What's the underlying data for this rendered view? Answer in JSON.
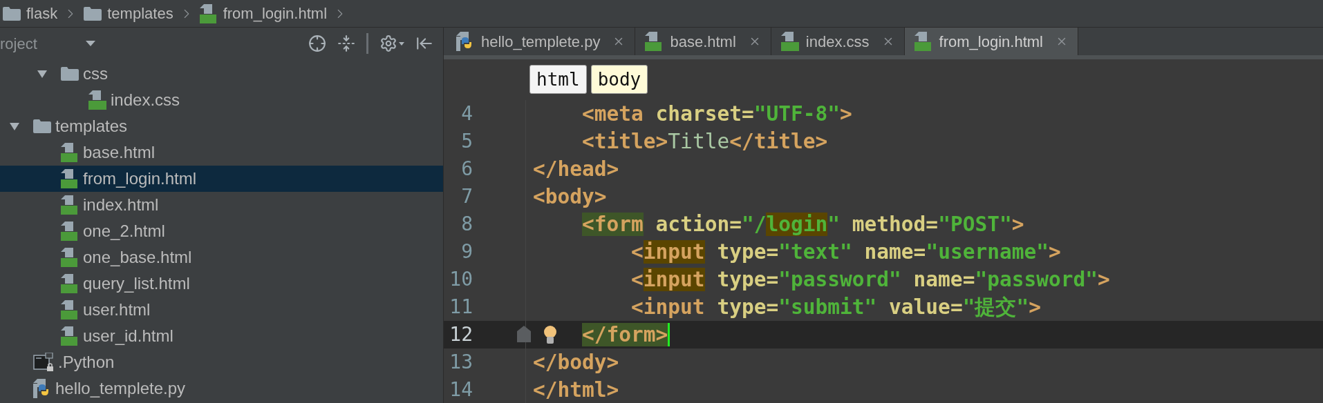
{
  "breadcrumbs": [
    {
      "label": "flask",
      "kind": "folder"
    },
    {
      "label": "templates",
      "kind": "folder"
    },
    {
      "label": "from_login.html",
      "kind": "html"
    }
  ],
  "project_panel": {
    "title": "roject",
    "tree": [
      {
        "kind": "offscreen",
        "children": [
          {
            "label": "css",
            "kind": "folder",
            "expanded": true,
            "selected": false,
            "children": [
              {
                "label": "index.css",
                "kind": "css",
                "selected": false
              }
            ]
          }
        ]
      },
      {
        "label": "templates",
        "kind": "folder",
        "expanded": true,
        "selected": false,
        "children": [
          {
            "label": "base.html",
            "kind": "html",
            "selected": false
          },
          {
            "label": "from_login.html",
            "kind": "html",
            "selected": true
          },
          {
            "label": "index.html",
            "kind": "html",
            "selected": false
          },
          {
            "label": "one_2.html",
            "kind": "html",
            "selected": false
          },
          {
            "label": "one_base.html",
            "kind": "html",
            "selected": false
          },
          {
            "label": "query_list.html",
            "kind": "html",
            "selected": false
          },
          {
            "label": "user.html",
            "kind": "html",
            "selected": false
          },
          {
            "label": "user_id.html",
            "kind": "html",
            "selected": false
          }
        ]
      },
      {
        "label": ".Python",
        "kind": "terminal",
        "selected": false
      },
      {
        "label": "hello_templete.py",
        "kind": "python",
        "selected": false
      }
    ]
  },
  "tabs": [
    {
      "label": "hello_templete.py",
      "kind": "python",
      "selected": false
    },
    {
      "label": "base.html",
      "kind": "html",
      "selected": false
    },
    {
      "label": "index.css",
      "kind": "css",
      "selected": false
    },
    {
      "label": "from_login.html",
      "kind": "html",
      "selected": true
    }
  ],
  "editor": {
    "breadcrumb": [
      {
        "label": "html",
        "selected": false
      },
      {
        "label": "body",
        "selected": true
      }
    ],
    "lines": [
      {
        "number": "4",
        "current": false,
        "bulb": false,
        "tokens": [
          {
            "text": "    <meta",
            "kind": "tag"
          },
          {
            "text": " charset=",
            "kind": "attr"
          },
          {
            "text": "\"UTF-8\"",
            "kind": "string"
          },
          {
            "text": ">",
            "kind": "tag"
          }
        ]
      },
      {
        "number": "5",
        "current": false,
        "bulb": false,
        "tokens": [
          {
            "text": "    <title>",
            "kind": "tag"
          },
          {
            "text": "Title",
            "kind": "text"
          },
          {
            "text": "</title>",
            "kind": "tag"
          }
        ]
      },
      {
        "number": "6",
        "current": false,
        "bulb": false,
        "tokens": [
          {
            "text": "</head>",
            "kind": "tag"
          }
        ]
      },
      {
        "number": "7",
        "current": false,
        "bulb": false,
        "tokens": [
          {
            "text": "<body>",
            "kind": "tag"
          }
        ]
      },
      {
        "number": "8",
        "current": false,
        "bulb": false,
        "tokens": [
          {
            "text": "    <form",
            "kind": "tag-pair"
          },
          {
            "text": " action=",
            "kind": "attr"
          },
          {
            "text": "\"/",
            "kind": "string"
          },
          {
            "text": "login",
            "kind": "string-hl"
          },
          {
            "text": "\"",
            "kind": "string"
          },
          {
            "text": " method=",
            "kind": "attr"
          },
          {
            "text": "\"POST\"",
            "kind": "string"
          },
          {
            "text": ">",
            "kind": "tag"
          }
        ]
      },
      {
        "number": "9",
        "current": false,
        "bulb": false,
        "tokens": [
          {
            "text": "        <",
            "kind": "tag"
          },
          {
            "text": "input",
            "kind": "tag-hl"
          },
          {
            "text": " type=",
            "kind": "attr"
          },
          {
            "text": "\"text\"",
            "kind": "string"
          },
          {
            "text": " name=",
            "kind": "attr"
          },
          {
            "text": "\"username\"",
            "kind": "string"
          },
          {
            "text": ">",
            "kind": "tag"
          }
        ]
      },
      {
        "number": "10",
        "current": false,
        "bulb": false,
        "tokens": [
          {
            "text": "        <",
            "kind": "tag"
          },
          {
            "text": "input",
            "kind": "tag-hl"
          },
          {
            "text": " type=",
            "kind": "attr"
          },
          {
            "text": "\"password\"",
            "kind": "string"
          },
          {
            "text": " name=",
            "kind": "attr"
          },
          {
            "text": "\"password\"",
            "kind": "string"
          },
          {
            "text": ">",
            "kind": "tag"
          }
        ]
      },
      {
        "number": "11",
        "current": false,
        "bulb": false,
        "tokens": [
          {
            "text": "        <input",
            "kind": "tag"
          },
          {
            "text": " type=",
            "kind": "attr"
          },
          {
            "text": "\"submit\"",
            "kind": "string"
          },
          {
            "text": " value=",
            "kind": "attr"
          },
          {
            "text": "\"提交\"",
            "kind": "string"
          },
          {
            "text": ">",
            "kind": "tag"
          }
        ]
      },
      {
        "number": "12",
        "current": true,
        "bulb": true,
        "tokens": [
          {
            "text": "    </form>",
            "kind": "tag-pair"
          }
        ]
      },
      {
        "number": "13",
        "current": false,
        "bulb": false,
        "tokens": [
          {
            "text": "</body>",
            "kind": "tag"
          }
        ]
      },
      {
        "number": "14",
        "current": false,
        "bulb": false,
        "tokens": [
          {
            "text": "</html>",
            "kind": "tag"
          }
        ]
      }
    ]
  }
}
